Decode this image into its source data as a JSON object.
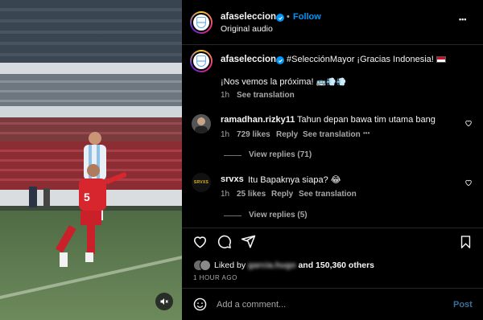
{
  "post": {
    "author": "afaseleccion",
    "follow_label": "Follow",
    "separator": "•",
    "subtitle": "Original audio",
    "more": "•••",
    "caption_text": "#SelecciónMayor ¡Gracias Indonesia!",
    "caption_line2": "¡Nos vemos la próxima!",
    "caption_time": "1h",
    "see_translation": "See translation"
  },
  "comments": [
    {
      "user": "ramadhan.rizky11",
      "text": "Tahun depan bawa tim utama bang",
      "time": "1h",
      "likes": "729 likes",
      "reply": "Reply",
      "see_translation": "See translation",
      "more": "•••",
      "view_replies": "View replies (71)"
    },
    {
      "user": "srvxs",
      "text": "Itu Bapaknya siapa? 😂",
      "time": "1h",
      "likes": "25 likes",
      "reply": "Reply",
      "see_translation": "See translation",
      "view_replies": "View replies (5)",
      "avatar_text": "SRVXS"
    }
  ],
  "likes_summary": {
    "prefix": "Liked by",
    "hidden_user": "garcia.hugo",
    "suffix": "and 150,360 others"
  },
  "time_ago": "1 HOUR AGO",
  "comment_box": {
    "placeholder": "Add a comment...",
    "post_label": "Post"
  },
  "colors": {
    "accent": "#0095f6",
    "background": "#000000",
    "muted": "#a8a8a8"
  }
}
